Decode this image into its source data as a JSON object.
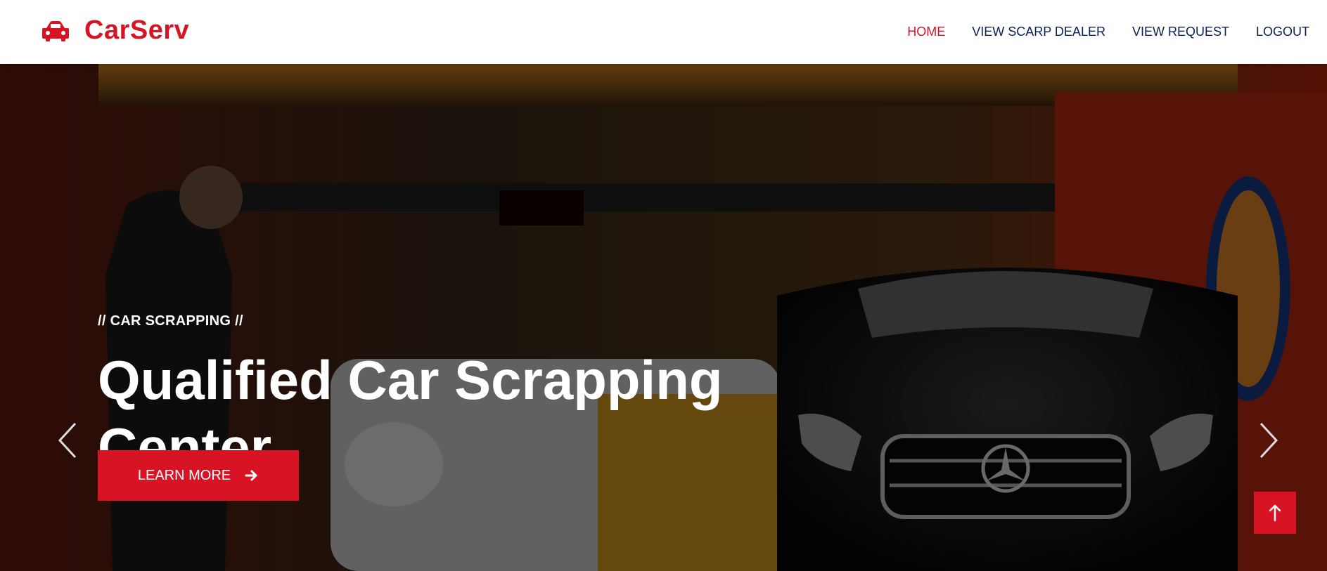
{
  "brand": {
    "name": "CarServ",
    "icon": "car-icon"
  },
  "nav": {
    "items": [
      {
        "label": "HOME",
        "active": true
      },
      {
        "label": "VIEW SCARP DEALER",
        "active": false
      },
      {
        "label": "VIEW REQUEST",
        "active": false
      },
      {
        "label": "LOGOUT",
        "active": false
      }
    ]
  },
  "hero": {
    "eyebrow": "// CAR SCRAPPING //",
    "headline": "Qualified Car Scrapping Center",
    "cta_label": "LEARN MORE",
    "cta_icon": "arrow-right-icon",
    "prev_icon": "chevron-left-icon",
    "next_icon": "chevron-right-icon"
  },
  "back_to_top": {
    "icon": "arrow-up-icon"
  },
  "colors": {
    "accent": "#d81324",
    "nav_text": "#0b2154",
    "white": "#ffffff"
  }
}
